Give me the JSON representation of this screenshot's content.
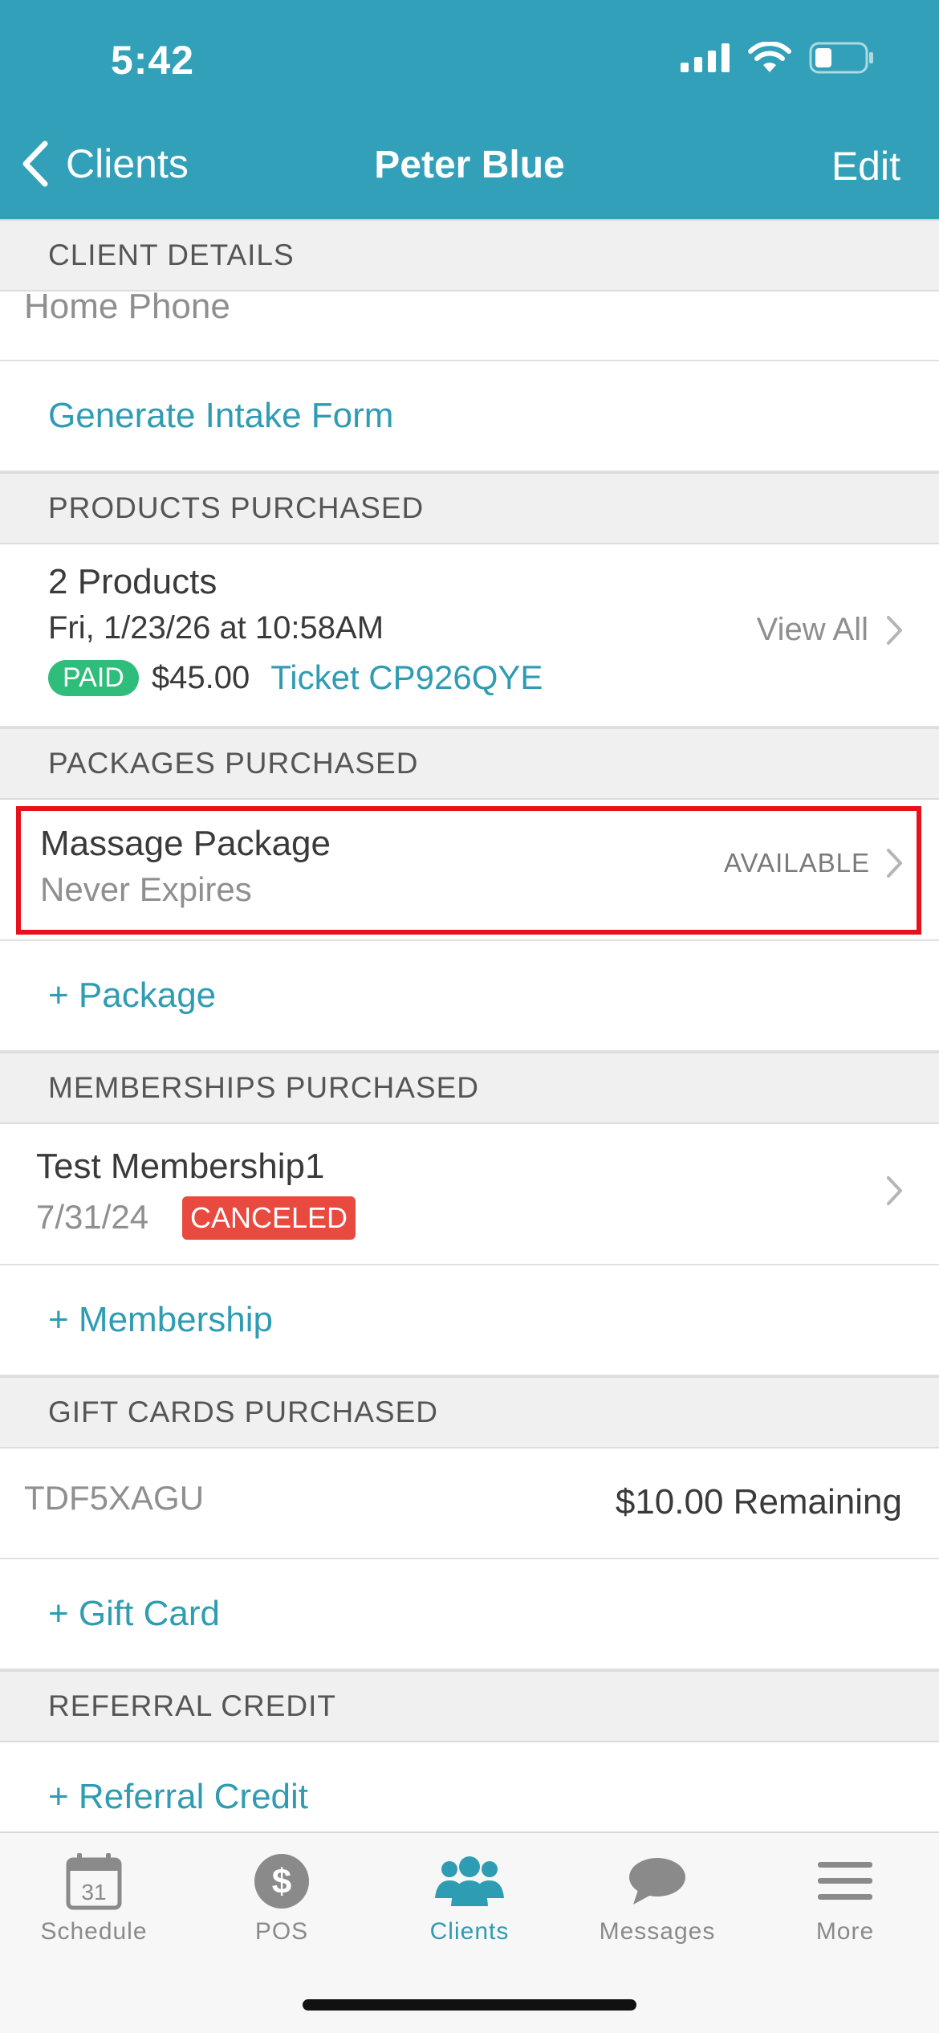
{
  "status_bar": {
    "time": "5:42"
  },
  "nav": {
    "back_label": "Clients",
    "title": "Peter Blue",
    "edit_label": "Edit"
  },
  "client_details": {
    "header": "CLIENT DETAILS",
    "home_phone_label": "Home Phone",
    "intake_form_label": "Generate Intake Form"
  },
  "products": {
    "header": "PRODUCTS PURCHASED",
    "title": "2 Products",
    "date": "Fri, 1/23/26 at 10:58AM",
    "paid_badge": "PAID",
    "amount": "$45.00",
    "ticket": "Ticket CP926QYE",
    "view_all": "View All"
  },
  "packages": {
    "header": "PACKAGES PURCHASED",
    "title": "Massage Package",
    "subtitle": "Never Expires",
    "status": "AVAILABLE",
    "add_label": "+ Package"
  },
  "memberships": {
    "header": "MEMBERSHIPS PURCHASED",
    "title": "Test Membership1",
    "date": "7/31/24",
    "status": "CANCELED",
    "add_label": "+ Membership"
  },
  "gift_cards": {
    "header": "GIFT CARDS PURCHASED",
    "code": "TDF5XAGU",
    "remaining": "$10.00 Remaining",
    "add_label": "+ Gift Card"
  },
  "referral": {
    "header": "REFERRAL CREDIT",
    "add_label": "+ Referral Credit"
  },
  "tabbar": {
    "tabs": [
      {
        "label": "Schedule",
        "icon": "calendar-icon",
        "calendar_day": "31"
      },
      {
        "label": "POS",
        "icon": "dollar-icon"
      },
      {
        "label": "Clients",
        "icon": "clients-icon",
        "active": true
      },
      {
        "label": "Messages",
        "icon": "chat-icon"
      },
      {
        "label": "More",
        "icon": "menu-icon"
      }
    ]
  },
  "colors": {
    "header_bg": "#32a0b8",
    "link": "#2e9cb2",
    "paid": "#2ebd7a",
    "canceled": "#e84a3f",
    "highlight": "#e8101a"
  }
}
